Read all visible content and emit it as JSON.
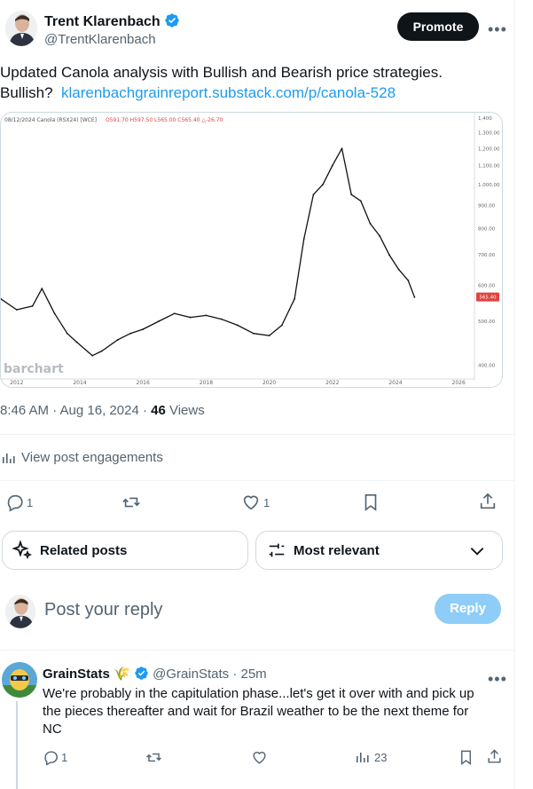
{
  "post": {
    "author_name": "Trent Klarenbach",
    "author_handle": "@TrentKlarenbach",
    "promote_label": "Promote",
    "text_line1": "Updated Canola analysis with Bullish and Bearish price strategies.",
    "text_prefix": "Bullish?",
    "link_text": "klarenbachgrainreport.substack.com/p/canola-528",
    "time": "8:46 AM · Aug 16, 2024 · ",
    "views_count": "46",
    "views_label": " Views",
    "engagements_label": "View post engagements",
    "reply_count": "1",
    "retweet_count": "",
    "like_count": "1"
  },
  "chart_header": {
    "header_date": "08/12/2024 Canola (RSX24) [WCE]",
    "header_values": "O591.70 H597.50 L565.00 C565.40 △-26.70",
    "watermark": "barchart",
    "last_price": "565.40"
  },
  "chart_data": {
    "type": "line",
    "title": "Canola (RSX24) [WCE]",
    "x_ticks": [
      "2012",
      "2014",
      "2016",
      "2018",
      "2020",
      "2022",
      "2024",
      "2026"
    ],
    "y_ticks": [
      "1,400",
      "1,300.00",
      "1,200.00",
      "1,100.00",
      "1,000.00",
      "900.00",
      "800.00",
      "700.00",
      "600.00",
      "500.00",
      "400.00"
    ],
    "y_scale": "log",
    "ylim": [
      380,
      1400
    ],
    "xlim": [
      2011.5,
      2026.5
    ],
    "series": [
      {
        "x": [
          2011.5,
          2012.0,
          2012.5,
          2012.8,
          2013.2,
          2013.6,
          2013.9,
          2014.4,
          2014.7,
          2015.2,
          2015.6,
          2016.0,
          2016.5,
          2017.0,
          2017.5,
          2018.0,
          2018.5,
          2019.0,
          2019.5,
          2020.0,
          2020.4,
          2020.8,
          2021.1,
          2021.4,
          2021.7,
          2022.0,
          2022.3,
          2022.6,
          2022.9,
          2023.2,
          2023.5,
          2023.8,
          2024.1,
          2024.4,
          2024.6
        ],
        "y": [
          560,
          530,
          540,
          590,
          520,
          470,
          450,
          420,
          430,
          455,
          470,
          480,
          500,
          520,
          510,
          515,
          505,
          490,
          470,
          465,
          490,
          560,
          760,
          950,
          1000,
          1100,
          1200,
          950,
          920,
          820,
          770,
          700,
          650,
          615,
          565
        ]
      }
    ]
  },
  "related": {
    "related_label": "Related posts",
    "sort_label": "Most relevant"
  },
  "composer": {
    "placeholder": "Post your reply",
    "reply_label": "Reply"
  },
  "reply": {
    "author_name": "GrainStats",
    "author_handle": "@GrainStats",
    "time": "· 25m",
    "text_line1": "We're probably in the capitulation phase...let's get it over with and pick up",
    "text_line2": "the pieces thereafter and wait for Brazil weather to be the next theme for",
    "text_line3": "NC",
    "reply_count": "1",
    "views": "23"
  },
  "colors": {
    "accent": "#1d9bf0",
    "text": "#0f1419",
    "muted": "#536471",
    "price_tag": "#e0433f"
  }
}
